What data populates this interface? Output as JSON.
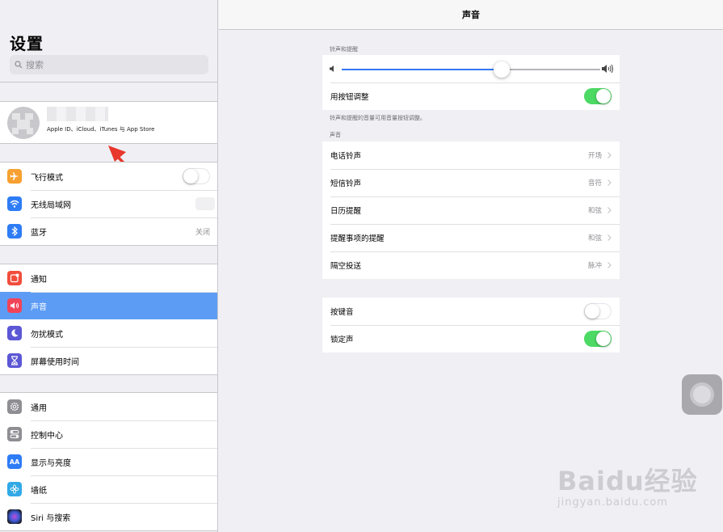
{
  "sidebar": {
    "title": "设置",
    "search_placeholder": "搜索",
    "profile": {
      "subtitle": "Apple ID、iCloud、iTunes 与 App Store"
    },
    "group1": [
      {
        "label": "飞行模式",
        "icon": "airplane-icon",
        "color": "#f7a031",
        "toggle": "off"
      },
      {
        "label": "无线局域网",
        "icon": "wifi-icon",
        "color": "#2e7cf6"
      },
      {
        "label": "蓝牙",
        "icon": "bluetooth-icon",
        "color": "#2e7cf6",
        "value": "关闭"
      }
    ],
    "group2": [
      {
        "label": "通知",
        "icon": "notifications-icon",
        "color": "#f24d3c"
      },
      {
        "label": "声音",
        "icon": "speaker-icon",
        "color": "#f24458",
        "active": true
      },
      {
        "label": "勿扰模式",
        "icon": "moon-icon",
        "color": "#5c57d5"
      },
      {
        "label": "屏幕使用时间",
        "icon": "hourglass-icon",
        "color": "#5c57d5"
      }
    ],
    "group3": [
      {
        "label": "通用",
        "icon": "gear-icon",
        "color": "#8e8e93"
      },
      {
        "label": "控制中心",
        "icon": "control-center-icon",
        "color": "#8e8e93"
      },
      {
        "label": "显示与亮度",
        "icon": "display-aa-icon",
        "color": "#2e7cf6"
      },
      {
        "label": "墙纸",
        "icon": "wallpaper-flower-icon",
        "color": "#32a9e6"
      },
      {
        "label": "Siri 与搜索",
        "icon": "siri-icon",
        "color": "#222"
      }
    ]
  },
  "main": {
    "title": "声音",
    "ringer_section": {
      "label": "铃声和提醒",
      "volume_level": 0.62,
      "change_with_buttons_label": "用按钮调整",
      "change_with_buttons": "on",
      "note": "铃声和提醒的音量可用音量按钮调整。"
    },
    "sounds_section": {
      "label": "声音",
      "rows": [
        {
          "label": "电话铃声",
          "value": "开场"
        },
        {
          "label": "短信铃声",
          "value": "音符"
        },
        {
          "label": "日历提醒",
          "value": "和弦"
        },
        {
          "label": "提醒事项的提醒",
          "value": "和弦"
        },
        {
          "label": "隔空投送",
          "value": "脉冲"
        }
      ]
    },
    "toggles_section": [
      {
        "label": "按键音",
        "state": "off"
      },
      {
        "label": "锁定声",
        "state": "on"
      }
    ]
  },
  "watermark": {
    "main": "Baidu经验",
    "sub": "jingyan.baidu.com"
  },
  "colors": {
    "accent": "#3478f6",
    "toggle_on": "#4cd964",
    "active_row": "#5d9cf5",
    "arrow": "#e8372c"
  }
}
